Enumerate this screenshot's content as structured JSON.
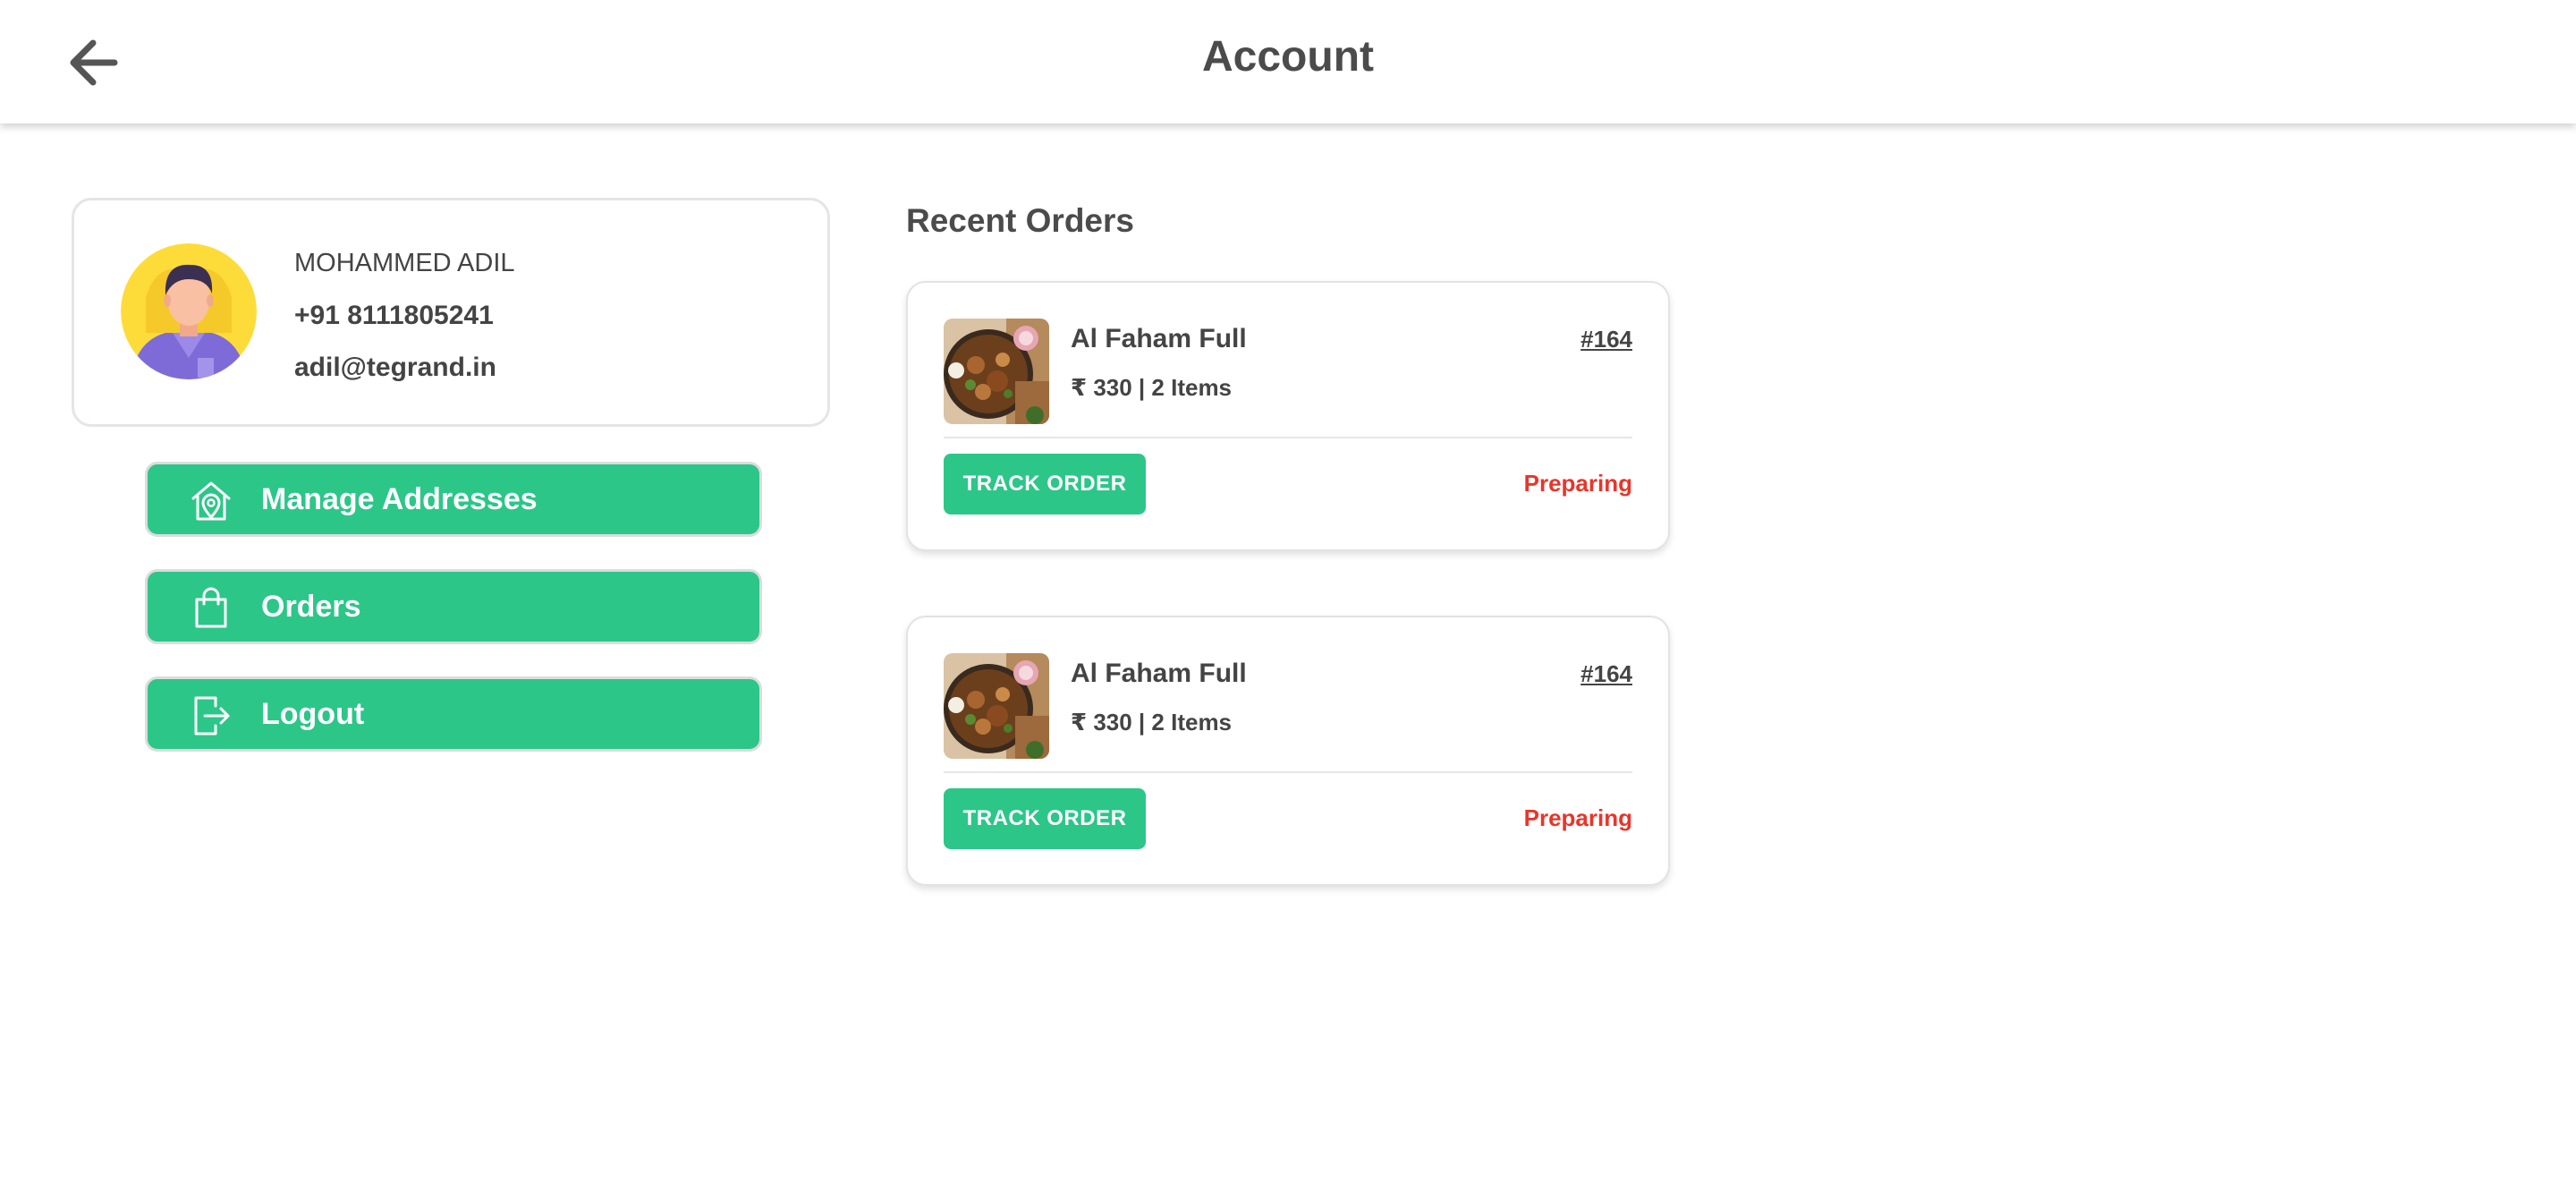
{
  "header": {
    "title": "Account",
    "back_icon": "arrow-left-icon"
  },
  "profile": {
    "name": "MOHAMMED ADIL",
    "phone": "+91 8111805241",
    "email": "adil@tegrand.in",
    "avatar_icon": "user-avatar"
  },
  "menu": {
    "items": [
      {
        "label": "Manage Addresses",
        "icon": "home-location-icon"
      },
      {
        "label": "Orders",
        "icon": "shopping-bag-icon"
      },
      {
        "label": "Logout",
        "icon": "logout-icon"
      }
    ]
  },
  "recent_orders": {
    "title": "Recent Orders",
    "orders": [
      {
        "item": "Al Faham Full",
        "order_id": "#164",
        "meta": "₹ 330 | 2 Items",
        "track_label": "TRACK ORDER",
        "status": "Preparing"
      },
      {
        "item": "Al Faham Full",
        "order_id": "#164",
        "meta": "₹ 330 | 2 Items",
        "track_label": "TRACK ORDER",
        "status": "Preparing"
      }
    ]
  },
  "colors": {
    "accent": "#2cc689",
    "status_preparing": "#e9352a",
    "text": "#4a4a4a"
  }
}
